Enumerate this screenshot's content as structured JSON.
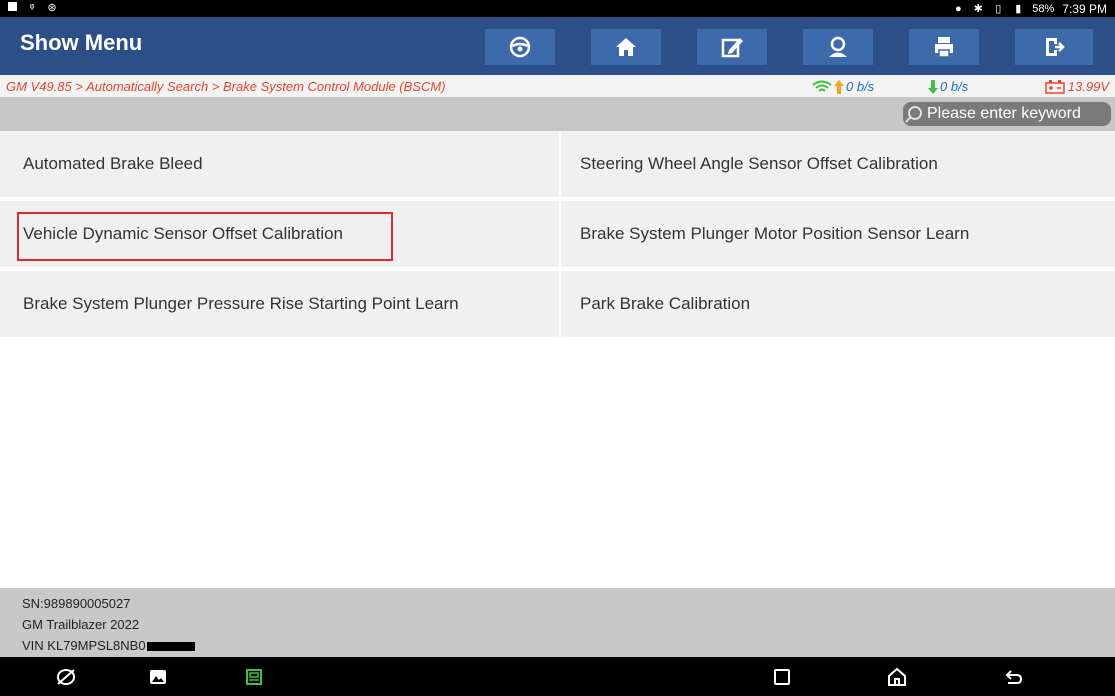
{
  "status_bar": {
    "battery": "58%",
    "time": "7:39 PM",
    "icons": [
      "gallery-icon",
      "usb-icon",
      "bluetooth-icon",
      "location-icon",
      "bluetooth-icon",
      "vibrate-icon",
      "battery-icon"
    ]
  },
  "header": {
    "title": "Show Menu",
    "buttons": [
      "steering-wheel-icon",
      "home-icon",
      "edit-report-icon",
      "user-icon",
      "print-icon",
      "exit-icon"
    ],
    "color": "#2c4f88"
  },
  "breadcrumb": {
    "text": "GM V49.85 > Automatically Search > Brake System Control Module (BSCM)",
    "upload": "0 b/s",
    "download": "0 b/s",
    "voltage": "13.99V"
  },
  "search": {
    "placeholder": "Please enter keyword"
  },
  "menu": {
    "items": [
      "Automated Brake Bleed",
      "Steering Wheel Angle Sensor Offset Calibration",
      "Vehicle Dynamic Sensor Offset Calibration",
      "Brake System Plunger Motor Position Sensor Learn",
      "Brake System Plunger Pressure Rise Starting Point Learn",
      "Park Brake Calibration"
    ],
    "highlighted_item": "Vehicle Dynamic Sensor Offset Calibration",
    "highlight_color": "#e0292e"
  },
  "footer": {
    "sn": "SN:989890005027",
    "vehicle": "GM Trailblazer 2022",
    "vin": "VIN KL79MPSL8NB0"
  },
  "nav_bar": {
    "icons": [
      "browser-icon",
      "gallery-icon",
      "vci-icon",
      "recents-icon",
      "home-icon",
      "back-icon"
    ]
  }
}
